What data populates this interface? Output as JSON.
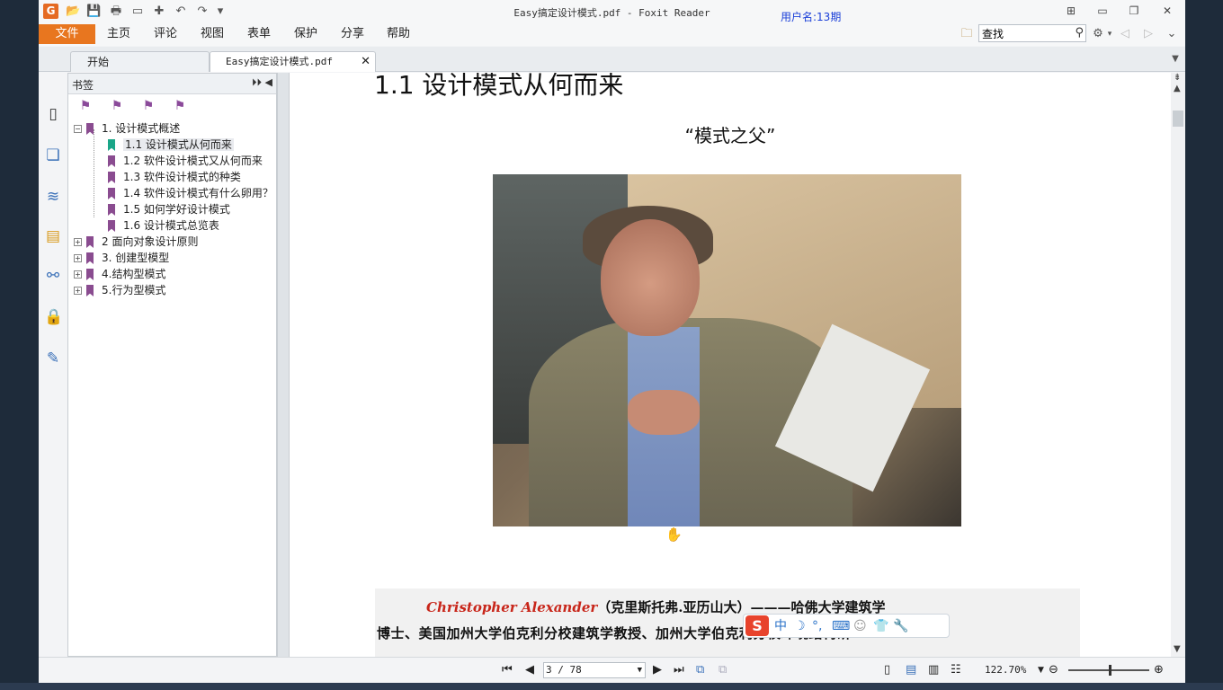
{
  "window": {
    "title": "Easy搞定设计模式.pdf - Foxit Reader",
    "username": "用户名:13期",
    "logo_letter": "G"
  },
  "menu": {
    "file": "文件",
    "items": [
      "主页",
      "评论",
      "视图",
      "表单",
      "保护",
      "分享",
      "帮助"
    ]
  },
  "search": {
    "value": "查找"
  },
  "tabs": {
    "start": "开始",
    "doc": "Easy搞定设计模式.pdf"
  },
  "panel": {
    "title": "书签",
    "bookmarks": [
      {
        "label": "1. 设计模式概述",
        "level": 0,
        "expand": "−"
      },
      {
        "label": "1.1 设计模式从何而来",
        "level": 1,
        "active": true
      },
      {
        "label": "1.2 软件设计模式又从何而来",
        "level": 1
      },
      {
        "label": "1.3 软件设计模式的种类",
        "level": 1
      },
      {
        "label": "1.4 软件设计模式有什么卵用？",
        "level": 1
      },
      {
        "label": "1.5 如何学好设计模式",
        "level": 1
      },
      {
        "label": "1.6 设计模式总览表",
        "level": 1
      },
      {
        "label": "2 面向对象设计原则",
        "level": 0,
        "expand": "+"
      },
      {
        "label": "3. 创建型模型",
        "level": 0,
        "expand": "+"
      },
      {
        "label": "4.结构型模式",
        "level": 0,
        "expand": "+"
      },
      {
        "label": "5.行为型模式",
        "level": 0,
        "expand": "+"
      }
    ]
  },
  "document": {
    "heading": "1.1 设计模式从何而来",
    "subheading": "“模式之父”",
    "caption_name": "Christopher Alexander",
    "caption_line1_rest": "（克里斯托弗.亚历山大）———哈佛大学建筑学",
    "caption_line2": "博士、美国加州大学伯克利分校建筑学教授、加州大学伯克利分校环境结构研"
  },
  "ime": {
    "logo": "S",
    "mode": "中"
  },
  "statusbar": {
    "page": "3 / 78",
    "zoom": "122.70%"
  },
  "icons": {
    "quick_access": [
      "open-folder-icon",
      "save-icon",
      "print-icon",
      "scan-icon",
      "create-pdf-icon",
      "undo-icon",
      "redo-icon",
      "customize-icon"
    ],
    "left_strip": [
      "page-thumbnail-icon",
      "pages-icon",
      "layers-icon",
      "comments-icon",
      "attachments-icon",
      "security-icon",
      "signature-icon"
    ]
  },
  "colors": {
    "accent": "#e8761f",
    "bookmark": "#8a4c90",
    "bookmark_active": "#1aa688",
    "caption_name": "#c8261a",
    "username": "#1a3fd8"
  }
}
